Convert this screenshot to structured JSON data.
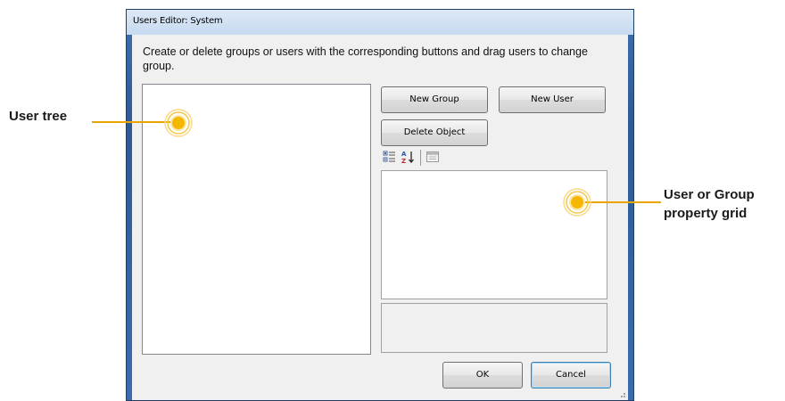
{
  "window": {
    "title": "Users Editor: System",
    "instruction": "Create or delete groups or users with the corresponding buttons and drag users to change group."
  },
  "buttons": {
    "new_group": "New Group",
    "new_user": "New User",
    "delete_object": "Delete Object",
    "ok": "OK",
    "cancel": "Cancel"
  },
  "toolbar": {
    "icons": [
      "categorized-icon",
      "alphabetical-sort-icon",
      "property-pages-icon"
    ]
  },
  "callouts": {
    "user_tree": "User tree",
    "property_grid_line1": "User or Group",
    "property_grid_line2": "property grid"
  },
  "colors": {
    "callout_accent": "#f5b800",
    "callout_line": "#e8a400",
    "titlebar": "#c7daf0",
    "window_frame": "#3a6cae",
    "dialog_bg": "#f0f0f0"
  }
}
